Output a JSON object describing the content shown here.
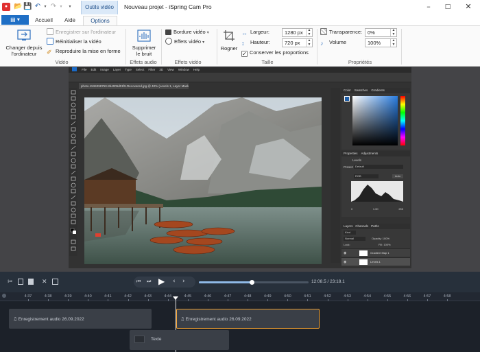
{
  "window": {
    "context_tab": "Outils vidéo",
    "title": "Nouveau projet - iSpring Cam Pro"
  },
  "tabs": [
    "Accueil",
    "Aide",
    "Options"
  ],
  "active_tab": "Options",
  "ribbon": {
    "video": {
      "change_label_1": "Changer depuis",
      "change_label_2": "l'ordinateur",
      "save_label": "Enregistrer sur l'ordinateur",
      "reset_label": "Réinitialiser la vidéo",
      "reproduce_label": "Reproduire la mise en forme",
      "group_label": "Vidéo"
    },
    "audio": {
      "noise_label_1": "Supprimer",
      "noise_label_2": "le bruit",
      "group_label": "Effets audio"
    },
    "effects": {
      "border_label": "Bordure vidéo",
      "effects_label": "Effets vidéo",
      "group_label": "Effets vidéo"
    },
    "size": {
      "crop_label": "Rogner",
      "width_label": "Largeur:",
      "width_value": "1280 px",
      "height_label": "Hauteur:",
      "height_value": "720 px",
      "keep_ratio_label": "Conserver les proportions",
      "group_label": "Taille"
    },
    "props": {
      "transparency_label": "Transparence:",
      "transparency_value": "0%",
      "volume_label": "Volume",
      "volume_value": "100%",
      "group_label": "Propriétés"
    }
  },
  "photoshop": {
    "menus": [
      "File",
      "Edit",
      "Image",
      "Layer",
      "Type",
      "Select",
      "Filter",
      "3D",
      "View",
      "Window",
      "Help"
    ],
    "doc_tab": "photo-1534298750-8b4005d01f9-Recovered.jpg @ 40% (Levels 1, Layer Mask/8) *",
    "panel_tabs": [
      "Color",
      "Swatches",
      "Gradients"
    ],
    "props_tabs": [
      "Properties",
      "Adjustments"
    ],
    "levels_label": "Levels",
    "preset_label": "Preset:",
    "preset_value": "Default",
    "channel_value": "RGB",
    "auto_label": "Auto",
    "input_levels": [
      "0",
      "1.00",
      "255"
    ],
    "layers_tabs": [
      "Layers",
      "Channels",
      "Paths"
    ],
    "layer_kind": "Kind",
    "blend_mode": "Normal",
    "opacity_label": "Opacity:",
    "opacity_value": "100%",
    "fill_label": "Fill:",
    "fill_value": "100%",
    "lock_label": "Lock:",
    "layers": [
      "Gradient Map 1",
      "Levels 1"
    ]
  },
  "player": {
    "time_display": "12:08.5 / 23:18.1",
    "progress": 0.48
  },
  "timeline": {
    "ticks": [
      "4:37",
      "4:38",
      "4:39",
      "4:40",
      "4:41",
      "4:42",
      "4:43",
      "4:44",
      "4:45",
      "4:46",
      "4:47",
      "4:48",
      "4:49",
      "4:50",
      "4:51",
      "4:52",
      "4:53",
      "4:54",
      "4:55",
      "4:56",
      "4:57",
      "4:58"
    ],
    "clip1_label": "Enregistrement audio 26.09.2022",
    "clip2_label": "Enregistrement audio 26.09.2022",
    "text_clip_label": "Texte"
  },
  "colors": {
    "accent": "#1f6fc5",
    "selected_clip_border": "#f0a030",
    "timeline_bg": "#1c2129"
  }
}
